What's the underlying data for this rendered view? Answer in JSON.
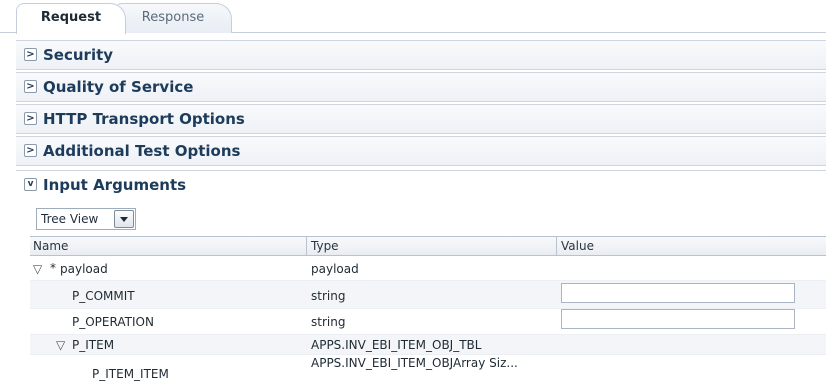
{
  "tabs": {
    "request": "Request",
    "response": "Response"
  },
  "sections": [
    {
      "label": "Security",
      "expanded": false,
      "icon": "expand-arrow-icon"
    },
    {
      "label": "Quality of Service",
      "expanded": false,
      "icon": "expand-arrow-icon"
    },
    {
      "label": "HTTP Transport Options",
      "expanded": false,
      "icon": "expand-arrow-icon"
    },
    {
      "label": "Additional Test Options",
      "expanded": false,
      "icon": "expand-arrow-icon"
    },
    {
      "label": "Input Arguments",
      "expanded": true,
      "icon": "collapse-arrow-icon"
    }
  ],
  "view_select": {
    "value": "Tree View"
  },
  "table": {
    "columns": [
      "Name",
      "Type",
      "Value"
    ],
    "rows": [
      {
        "twisty": "▽",
        "marker": "*",
        "name": "payload",
        "type": "payload",
        "has_input": false,
        "value": ""
      },
      {
        "twisty": "",
        "marker": "",
        "name": "P_COMMIT",
        "type": "string",
        "has_input": true,
        "value": ""
      },
      {
        "twisty": "",
        "marker": "",
        "name": "P_OPERATION",
        "type": "string",
        "has_input": true,
        "value": ""
      },
      {
        "twisty": "▽",
        "marker": "",
        "name": "P_ITEM",
        "type": "APPS.INV_EBI_ITEM_OBJ_TBL",
        "has_input": false,
        "value": ""
      },
      {
        "twisty": "",
        "marker": "",
        "name": "P_ITEM_ITEM",
        "type": "APPS.INV_EBI_ITEM_OBJArray Siz...",
        "has_input": false,
        "value": ""
      }
    ]
  },
  "colors": {
    "section_title": "#1d3b5a",
    "border": "#c5cfdb"
  }
}
